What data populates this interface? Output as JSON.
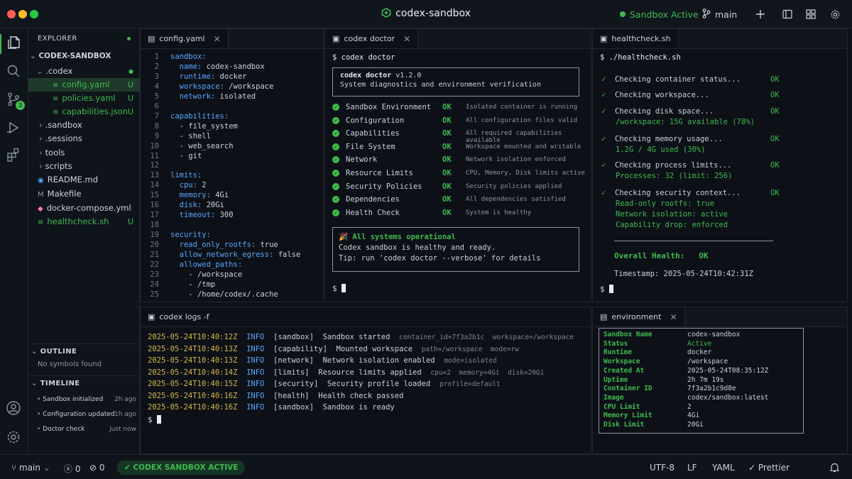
{
  "app": {
    "title": "codex-sandbox",
    "status": "Sandbox Active",
    "branch": "main"
  },
  "explorer": {
    "header": "EXPLORER",
    "root": "CODEX-SANDBOX",
    "codex_folder": ".codex",
    "files_codex": [
      {
        "name": "config.yaml",
        "mark": "U"
      },
      {
        "name": "policies.yaml",
        "mark": "U"
      },
      {
        "name": "capabilities.json",
        "mark": "U"
      }
    ],
    "folders": [
      ".sandbox",
      ".sessions",
      "tools",
      "scripts"
    ],
    "root_files": [
      {
        "name": "README.md",
        "mark": ""
      },
      {
        "name": "Makefile",
        "mark": ""
      },
      {
        "name": "docker-compose.yml",
        "mark": ""
      },
      {
        "name": "healthcheck.sh",
        "mark": "U"
      }
    ],
    "outline_header": "OUTLINE",
    "outline_empty": "No symbols found",
    "timeline_header": "TIMELINE",
    "timeline": [
      {
        "label": "Sandbox initialized",
        "time": "2h ago"
      },
      {
        "label": "Configuration updated",
        "time": "1h ago"
      },
      {
        "label": "Doctor check",
        "time": "just now"
      }
    ],
    "scm_badge": "3"
  },
  "config": {
    "tab": "config.yaml",
    "lines": [
      [
        "sandbox:",
        "",
        ""
      ],
      [
        "  name: ",
        "codex-sandbox",
        ""
      ],
      [
        "  runtime: ",
        "docker",
        ""
      ],
      [
        "  workspace: ",
        "/workspace",
        ""
      ],
      [
        "  network: ",
        "isolated",
        ""
      ],
      [
        "",
        "",
        ""
      ],
      [
        "capabilities:",
        "",
        ""
      ],
      [
        "  - ",
        "file_system",
        ""
      ],
      [
        "  - ",
        "shell",
        ""
      ],
      [
        "  - ",
        "web_search",
        ""
      ],
      [
        "  - ",
        "git",
        ""
      ],
      [
        "",
        "",
        ""
      ],
      [
        "limits:",
        "",
        ""
      ],
      [
        "  cpu: ",
        "2",
        ""
      ],
      [
        "  memory: ",
        "4Gi",
        ""
      ],
      [
        "  disk: ",
        "20Gi",
        ""
      ],
      [
        "  timeout: ",
        "300",
        ""
      ],
      [
        "",
        "",
        ""
      ],
      [
        "security:",
        "",
        ""
      ],
      [
        "  read_only_rootfs: ",
        "true",
        ""
      ],
      [
        "  allow_network_egress: ",
        "false",
        ""
      ],
      [
        "  allowed_paths:",
        "",
        ""
      ],
      [
        "    - ",
        "/workspace",
        ""
      ],
      [
        "    - ",
        "/tmp",
        ""
      ],
      [
        "    - ",
        "/home/codex/.cache",
        ""
      ]
    ]
  },
  "doctor": {
    "tab": "codex doctor",
    "cmd": "$ codex doctor",
    "box_title": "codex doctor",
    "box_version": "v1.2.0",
    "box_sub": "System diagnostics and environment verification",
    "checks": [
      {
        "name": "Sandbox Environment",
        "status": "OK",
        "detail": "Isolated container is running"
      },
      {
        "name": "Configuration",
        "status": "OK",
        "detail": "All configuration files valid"
      },
      {
        "name": "Capabilities",
        "status": "OK",
        "detail": "All required capabilities available"
      },
      {
        "name": "File System",
        "status": "OK",
        "detail": "Workspace mounted and writable"
      },
      {
        "name": "Network",
        "status": "OK",
        "detail": "Network isolation enforced"
      },
      {
        "name": "Resource Limits",
        "status": "OK",
        "detail": "CPU, Memory, Disk limits active"
      },
      {
        "name": "Security Policies",
        "status": "OK",
        "detail": "Security policies applied"
      },
      {
        "name": "Dependencies",
        "status": "OK",
        "detail": "All dependencies satisfied"
      },
      {
        "name": "Health Check",
        "status": "OK",
        "detail": "System is healthy"
      }
    ],
    "summary_title": "All systems operational",
    "summary_l1": "Codex sandbox is healthy and ready.",
    "summary_l2": "Tip: run 'codex doctor --verbose' for details",
    "prompt": "$"
  },
  "health": {
    "tab": "healthcheck.sh",
    "cmd": "$ ./healthcheck.sh",
    "checks": [
      {
        "label": "Checking container status...",
        "status": "OK",
        "sub": []
      },
      {
        "label": "Checking workspace...",
        "status": "OK",
        "sub": []
      },
      {
        "label": "Checking disk space...",
        "status": "OK",
        "sub": [
          "/workspace: 15G available (78%)"
        ]
      },
      {
        "label": "Checking memory usage...",
        "status": "OK",
        "sub": [
          "1.2G / 4G used (30%)"
        ]
      },
      {
        "label": "Checking process limits...",
        "status": "OK",
        "sub": [
          "Processes: 32 (limit: 256)"
        ]
      },
      {
        "label": "Checking security context...",
        "status": "OK",
        "sub": [
          "Read-only rootfs: true",
          "Network isolation: active",
          "Capability drop: enforced"
        ]
      }
    ],
    "overall_label": "Overall Health:",
    "overall_status": "OK",
    "timestamp": "Timestamp: 2025-05-24T10:42:31Z",
    "prompt": "$"
  },
  "logs": {
    "tab": "codex logs -f",
    "entries": [
      {
        "ts": "2025-05-24T10:40:12Z",
        "lvl": "INFO",
        "src": "[sandbox]",
        "msg": "Sandbox started",
        "meta": "container_id=7f3a2b1c  workspace=/workspace"
      },
      {
        "ts": "2025-05-24T10:40:13Z",
        "lvl": "INFO",
        "src": "[capability]",
        "msg": "Mounted workspace",
        "meta": "path=/workspace  mode=rw"
      },
      {
        "ts": "2025-05-24T10:40:13Z",
        "lvl": "INFO",
        "src": "[network]",
        "msg": "Network isolation enabled",
        "meta": "mode=isolated"
      },
      {
        "ts": "2025-05-24T10:40:14Z",
        "lvl": "INFO",
        "src": "[limits]",
        "msg": "Resource limits applied",
        "meta": "cpu=2  memory=4Gi  disk=20Gi"
      },
      {
        "ts": "2025-05-24T10:40:15Z",
        "lvl": "INFO",
        "src": "[security]",
        "msg": "Security profile loaded",
        "meta": "profile=default"
      },
      {
        "ts": "2025-05-24T10:40:16Z",
        "lvl": "INFO",
        "src": "[health]",
        "msg": "Health check passed",
        "meta": ""
      },
      {
        "ts": "2025-05-24T10:40:16Z",
        "lvl": "INFO",
        "src": "[sandbox]",
        "msg": "Sandbox is ready",
        "meta": ""
      }
    ],
    "prompt": "$"
  },
  "env": {
    "tab": "environment",
    "rows": [
      [
        "Sandbox Name",
        "codex-sandbox"
      ],
      [
        "Status",
        "Active"
      ],
      [
        "Runtime",
        "docker"
      ],
      [
        "Workspace",
        "/workspace"
      ],
      [
        "Created At",
        "2025-05-24T08:35:12Z"
      ],
      [
        "Uptime",
        "2h 7m 19s"
      ],
      [
        "Container ID",
        "7f3a2b1c9d8e"
      ],
      [
        "Image",
        "codex/sandbox:latest"
      ],
      [
        "CPU Limit",
        "2"
      ],
      [
        "Memory Limit",
        "4Gi"
      ],
      [
        "Disk Limit",
        "20Gi"
      ]
    ]
  },
  "status": {
    "branch": "main",
    "errors": "0",
    "warnings": "0",
    "badge": "CODEX SANDBOX ACTIVE",
    "encoding": "UTF-8",
    "eol": "LF",
    "lang": "YAML",
    "formatter": "Prettier"
  },
  "colors": {
    "accent": "#3fb950",
    "key": "#58a6ff",
    "bg": "#0d1117"
  }
}
